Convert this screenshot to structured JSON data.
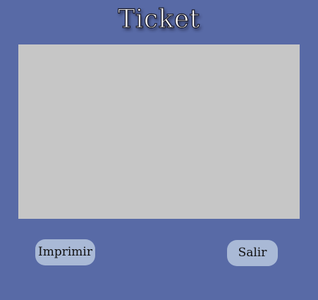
{
  "window": {
    "title": "Ticket"
  },
  "ticket": {
    "content": ""
  },
  "actions": {
    "print_label": "Imprimir",
    "exit_label": "Salir"
  },
  "colors": {
    "background": "#586aa6",
    "ticket_area": "#c6c6c6",
    "button": "#a9b9d6",
    "title_text": "#ffffff"
  }
}
